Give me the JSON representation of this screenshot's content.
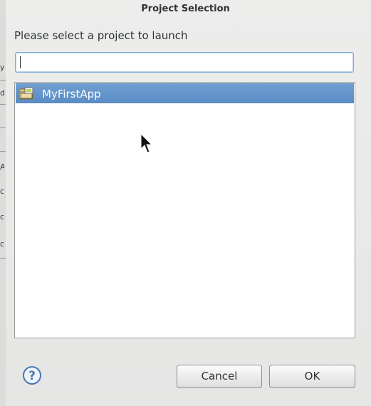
{
  "dialog": {
    "title": "Project Selection",
    "prompt": "Please select a project to launch",
    "filter": {
      "value": "",
      "placeholder": ""
    },
    "projects": [
      {
        "name": "MyFirstApp",
        "selected": true,
        "icon": "android-project-folder-icon"
      }
    ],
    "buttons": {
      "cancel": "Cancel",
      "ok": "OK"
    },
    "help_icon": "help-icon"
  },
  "colors": {
    "selection": "#5a8bc4",
    "focus_border": "#7eaed9",
    "background": "#e8e8e7"
  }
}
